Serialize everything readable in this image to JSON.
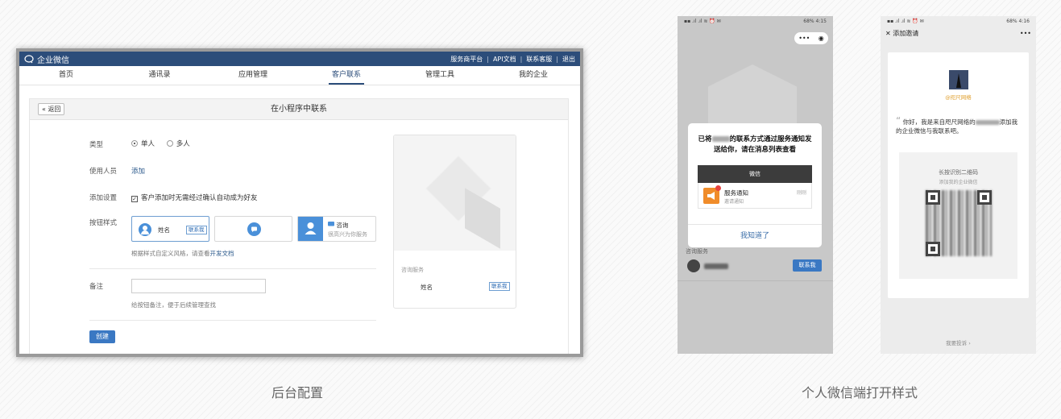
{
  "admin": {
    "brand": "企业微信",
    "top_links": [
      "服务商平台",
      "API文档",
      "联系客服",
      "退出"
    ],
    "nav": [
      "首页",
      "通讯录",
      "应用管理",
      "客户联系",
      "管理工具",
      "我的企业"
    ],
    "active_nav": "客户联系",
    "back_label": "返回",
    "page_title": "在小程序中联系",
    "form": {
      "type_label": "类型",
      "type_options": [
        "单人",
        "多人"
      ],
      "type_selected": "单人",
      "users_label": "使用人员",
      "users_add": "添加",
      "setting_label": "添加设置",
      "setting_text": "客户添加时无需经过确认自动成为好友",
      "setting_checked": true,
      "style_label": "按钮样式",
      "style_card1_name": "姓名",
      "style_card1_btn": "联系我",
      "style_card3_title": "咨询",
      "style_card3_sub": "很高兴为你服务",
      "style_hint": "根据样式自定义风格，请查看",
      "style_hint_link": "开发文档",
      "note_label": "备注",
      "note_value": "",
      "note_hint": "给按钮备注，便于后续管理查找",
      "create_label": "创建"
    },
    "preview": {
      "section": "咨询服务",
      "name": "姓名",
      "btn": "联系我"
    }
  },
  "phone1": {
    "status_right": "68% 4:15",
    "modal_title_prefix": "已将",
    "modal_title_suffix": "的联系方式通过服务通知发送给你，请在消息列表查看",
    "wechat_label": "微信",
    "notify_title": "服务通知",
    "notify_sub": "邀请通知",
    "notify_time": "刚刚",
    "ok_label": "我知道了",
    "bg_section": "咨询服务",
    "bg_btn": "联系我"
  },
  "phone2": {
    "status_right": "68% 4:16",
    "nav_title": "添加邀请",
    "company": "@咫尺网络",
    "msg_prefix": "你好，我是来自咫尺网络的",
    "msg_suffix": "添加我的企业微信与我联系吧。",
    "qr_title": "长按识别二维码",
    "qr_sub": "添加我的企业微信",
    "complain": "我要投诉 ›"
  },
  "captions": {
    "left": "后台配置",
    "right": "个人微信端打开样式"
  },
  "colors": {
    "brand_blue": "#2c4d7a",
    "button_blue": "#3a78c3",
    "wechat_dark": "#3c3c3c",
    "notify_orange": "#f08c2a"
  }
}
